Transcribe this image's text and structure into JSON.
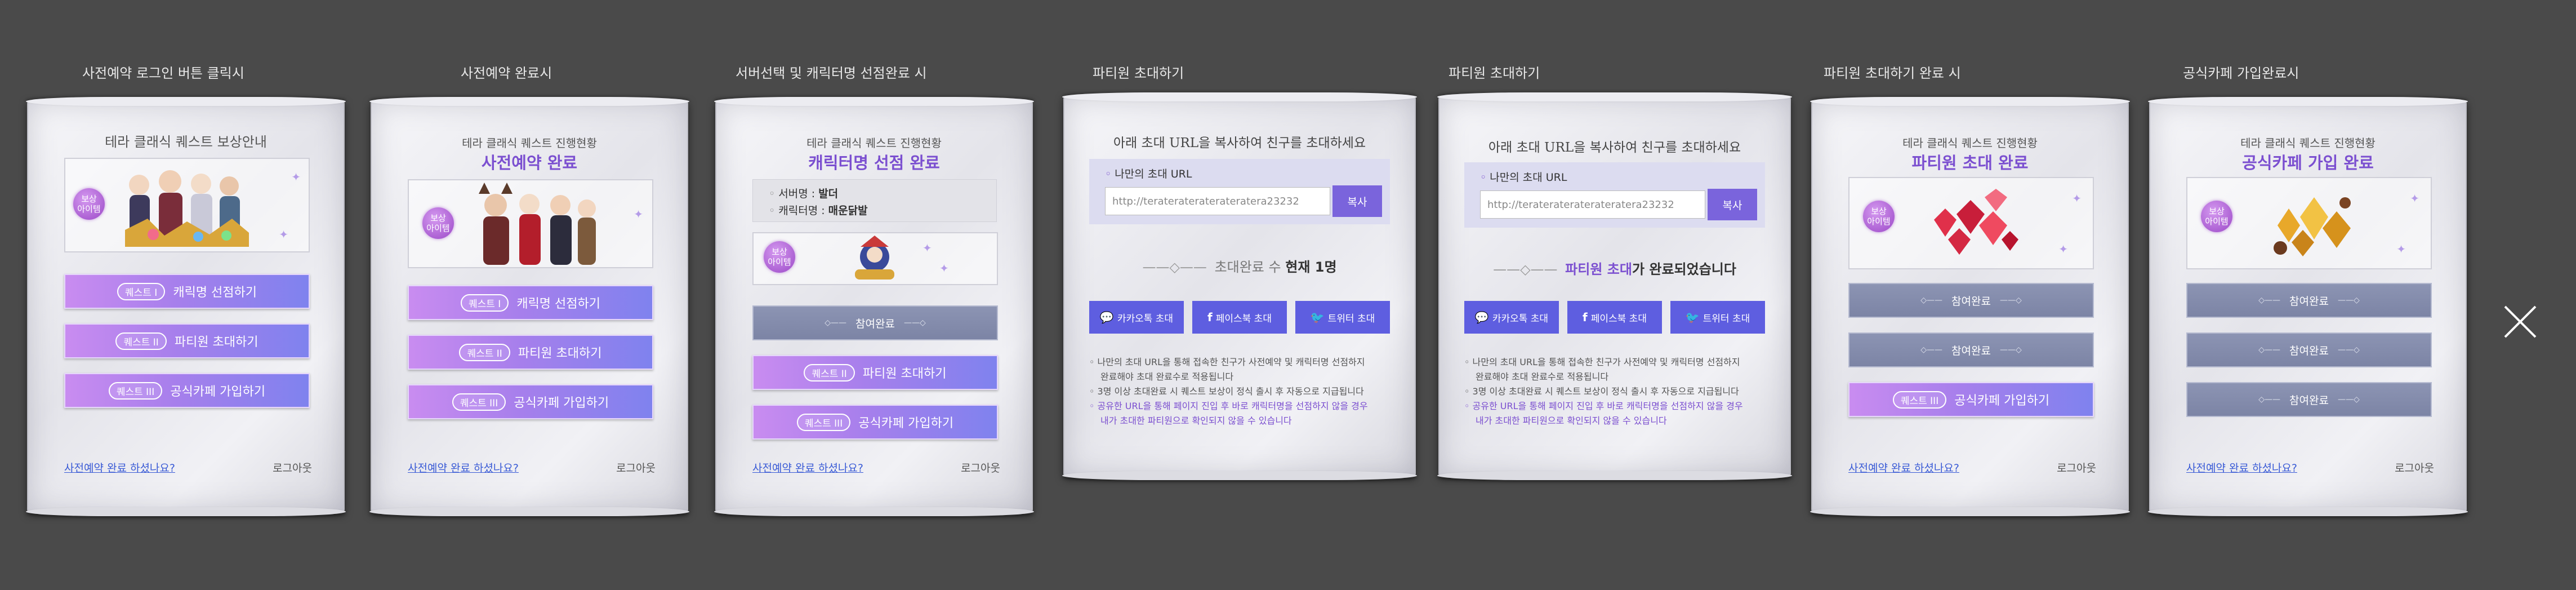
{
  "captions": [
    "사전예약 로그인 버튼 클릭시",
    "사전예약 완료시",
    "서버선택 및 캐릭터명 선점완료 시",
    "파티원 초대하기",
    "파티원 초대하기",
    "파티원 초대하기 완료 시",
    "공식카페 가입완료시"
  ],
  "panel1": {
    "title": "테라 클래식 퀘스트 보상안내",
    "badge": "보상\n아이템",
    "quests": [
      {
        "tag": "퀘스트 I",
        "label": "캐릭명 선점하기"
      },
      {
        "tag": "퀘스트 II",
        "label": "파티원 초대하기"
      },
      {
        "tag": "퀘스트 III",
        "label": "공식카페 가입하기"
      }
    ],
    "link": "사전예약 완료 하셨나요?",
    "logout": "로그아웃"
  },
  "panel2": {
    "title": "테라 클래식 퀘스트 진행현황",
    "subtitle": "사전예약 완료",
    "badge": "보상\n아이템",
    "quests": [
      {
        "tag": "퀘스트 I",
        "label": "캐릭명 선점하기"
      },
      {
        "tag": "퀘스트 II",
        "label": "파티원 초대하기"
      },
      {
        "tag": "퀘스트 III",
        "label": "공식카페 가입하기"
      }
    ],
    "link": "사전예약 완료 하셨나요?",
    "logout": "로그아웃"
  },
  "panel3": {
    "title": "테라 클래식 퀘스트 진행현황",
    "subtitle": "캐릭터명 선점 완료",
    "server_label": "서버명 :",
    "server_value": "발더",
    "char_label": "캐릭터명 :",
    "char_value": "매운닭발",
    "badge": "보상\n아이템",
    "done": "참여완료",
    "quests": [
      {
        "tag": "퀘스트 II",
        "label": "파티원 초대하기"
      },
      {
        "tag": "퀘스트 III",
        "label": "공식카페 가입하기"
      }
    ],
    "link": "사전예약 완료 하셨나요?",
    "logout": "로그아웃"
  },
  "panel4": {
    "title": "아래 초대 URL을 복사하여 친구를 초대하세요",
    "url_label": "나만의 초대 URL",
    "url_value": "http://teraterateraterateratera23232",
    "copy": "복사",
    "status_prefix": "초대완료 수",
    "status_count": "현재 1명",
    "share": [
      "카카오톡 초대",
      "페이스북 초대",
      "트위터 초대"
    ],
    "notes": [
      "나만의 초대 URL을 통해 접속한 친구가 사전예약 및 캐릭터명 선점하지",
      "완료해야 초대 완료수로 적용됩니다",
      "3명 이상 초대완료 시 퀘스트 보상이 정식 출시 후 자동으로 지급됩니다",
      "공유한 URL을 통해 페이지 진입 후 바로 캐릭터명을 선점하지 않을 경우",
      "내가 초대한 파티원으로 확인되지 않을 수 있습니다"
    ]
  },
  "panel5": {
    "title": "아래 초대 URL을 복사하여 친구를 초대하세요",
    "url_label": "나만의 초대 URL",
    "url_value": "http://teraterateraterateratera23232",
    "copy": "복사",
    "status_hl": "파티원 초대",
    "status_rest": "가 완료되었습니다",
    "share": [
      "카카오톡 초대",
      "페이스북 초대",
      "트위터 초대"
    ],
    "notes": [
      "나만의 초대 URL을 통해 접속한 친구가 사전예약 및 캐릭터명 선점하지",
      "완료해야 초대 완료수로 적용됩니다",
      "3명 이상 초대완료 시 퀘스트 보상이 정식 출시 후 자동으로 지급됩니다",
      "공유한 URL을 통해 페이지 진입 후 바로 캐릭터명을 선점하지 않을 경우",
      "내가 초대한 파티원으로 확인되지 않을 수 있습니다"
    ]
  },
  "panel6": {
    "title": "테라 클래식 퀘스트 진행현황",
    "subtitle": "파티원 초대 완료",
    "badge": "보상\n아이템",
    "done": "참여완료",
    "quests": [
      {
        "tag": "퀘스트 III",
        "label": "공식카페 가입하기"
      }
    ],
    "link": "사전예약 완료 하셨나요?",
    "logout": "로그아웃"
  },
  "panel7": {
    "title": "테라 클래식 퀘스트 진행현황",
    "subtitle": "공식카페 가입 완료",
    "badge": "보상\n아이템",
    "done": "참여완료",
    "link": "사전예약 완료 하셨나요?",
    "logout": "로그아웃"
  },
  "colors": {
    "background": "#4a4a4a",
    "accent_purple": "#7b4fd0",
    "quest_gradient_start": "#c98cf0",
    "quest_gradient_end": "#7f82ee",
    "done_gray": "#8c94b3",
    "share_blue": "#5e5ee0",
    "link_blue": "#3a5bd6"
  },
  "icons": {
    "close": "close-icon",
    "kakao": "chat-bubble-icon",
    "facebook": "facebook-icon",
    "twitter": "twitter-bird-icon"
  }
}
